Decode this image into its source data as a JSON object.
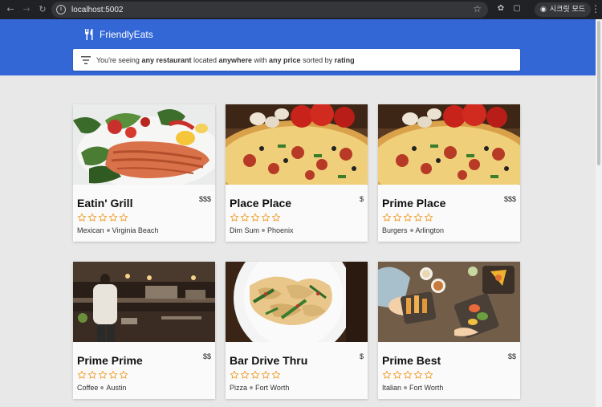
{
  "browser": {
    "url": "localhost:5002",
    "incognito_label": "시크릿 모드"
  },
  "app": {
    "brand": "FriendlyEats",
    "filter": {
      "prefix": "You're seeing ",
      "bold1": "any restaurant",
      "mid1": " located ",
      "bold2": "anywhere",
      "mid2": " with ",
      "bold3": "any price",
      "mid3": " sorted by ",
      "bold4": "rating"
    }
  },
  "restaurants": [
    {
      "name": "Eatin' Grill",
      "price": "$$$",
      "category": "Mexican",
      "city": "Virginia Beach",
      "rating": 0,
      "image": "salmon"
    },
    {
      "name": "Place Place",
      "price": "$",
      "category": "Dim Sum",
      "city": "Phoenix",
      "rating": 0,
      "image": "pizza"
    },
    {
      "name": "Prime Place",
      "price": "$$$",
      "category": "Burgers",
      "city": "Arlington",
      "rating": 0,
      "image": "pizza"
    },
    {
      "name": "Prime Prime",
      "price": "$$",
      "category": "Coffee",
      "city": "Austin",
      "rating": 0,
      "image": "kitchen"
    },
    {
      "name": "Bar Drive Thru",
      "price": "$",
      "category": "Pizza",
      "city": "Fort Worth",
      "rating": 0,
      "image": "pasta"
    },
    {
      "name": "Prime Best",
      "price": "$$",
      "category": "Italian",
      "city": "Fort Worth",
      "rating": 0,
      "image": "platter"
    }
  ],
  "colors": {
    "header": "#3367d6",
    "star": "#f0a030"
  }
}
